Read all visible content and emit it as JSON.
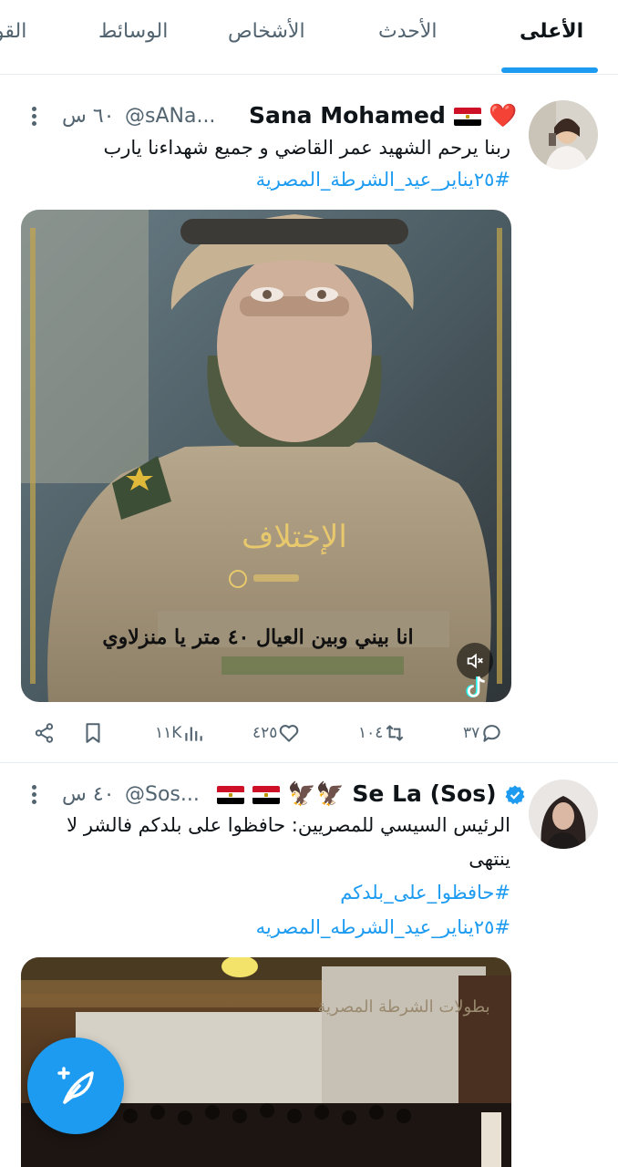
{
  "tabs": [
    {
      "label": "الأعلى",
      "active": true
    },
    {
      "label": "الأحدث"
    },
    {
      "label": "الأشخاص"
    },
    {
      "label": "الوسائط"
    },
    {
      "label": "القو"
    }
  ],
  "tweets": [
    {
      "display_name": "Sana Mohamed",
      "name_emoji": "❤️",
      "handle": "@sANa...",
      "time": "٦٠ س",
      "text": "ربنا يرحم الشهيد عمر القاضي و جميع شهداءنا يارب",
      "hashtags": [
        "#٢٥يناير_عيد_الشرطة_المصرية"
      ],
      "media": {
        "overlay_text_1": "الإختلاف",
        "overlay_text_2": "انا بيني وبين العيال ٤٠ متر يا منزلاوي",
        "muted": true,
        "icons": [
          "mute-icon",
          "tiktok-icon"
        ]
      },
      "actions": {
        "replies": "٣٧",
        "retweets": "١٠٤",
        "likes": "٤٢٥",
        "views": "١١K"
      }
    },
    {
      "display_name": "Se La (Sos)",
      "name_emoji": "🦅🦅",
      "verified": true,
      "handle": "@Sos...",
      "time": "٤٠ س",
      "text_line_1": "الرئيس السيسي للمصريين: حافظوا على بلدكم فالشر لا",
      "text_line_2": "ينتهى",
      "hashtags": [
        "#حافظوا_على_بلدكم",
        "#٢٥يناير_عيد_الشرطه_المصريه"
      ],
      "media": {
        "wall_text": "بطولات الشرطة المصرية"
      }
    }
  ],
  "colors": {
    "accent": "#1d9bf0",
    "text": "#0f1419",
    "secondary": "#536471",
    "divider": "#e6ecf0"
  }
}
